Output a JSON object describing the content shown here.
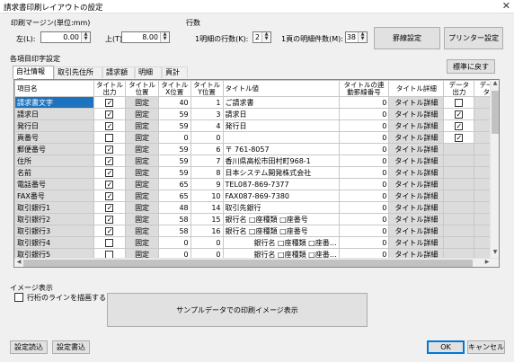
{
  "window": {
    "title": "請求書印刷レイアウトの設定",
    "close": "✕"
  },
  "margin": {
    "group_label": "印刷マージン(単位:mm)",
    "left_label": "左(L):",
    "left_value": "0.00",
    "top_label": "上(T):",
    "top_value": "8.00"
  },
  "rows_group": {
    "label": "行数",
    "detail_rows_label": "1明細の行数(K):",
    "detail_rows_value": "2",
    "page_rows_label": "1頁の明細件数(M):",
    "page_rows_value": "38"
  },
  "buttons": {
    "ruled_line": "罫線設定",
    "printer": "プリンター設定",
    "reset_default": "標準に戻す",
    "sample_preview": "サンプルデータでの印刷イメージ表示",
    "load_settings": "設定読込",
    "save_settings": "設定書込",
    "ok": "OK",
    "cancel": "キャンセル"
  },
  "items_group": {
    "label": "各項目印字設定"
  },
  "tabs": [
    "自社情報欄",
    "取引先住所欄",
    "請求額欄",
    "明細欄",
    "頁計欄"
  ],
  "grid": {
    "headers": [
      "項目名",
      "タイトル出力",
      "タイトル位置",
      "タイトルX位置",
      "タイトルY位置",
      "タイトル値",
      "タイトルの連動罫線番号",
      "タイトル詳細",
      "データ出力",
      "データ"
    ],
    "rows": [
      {
        "name": "請求書文字",
        "title_out": true,
        "pos": "固定",
        "x": "40",
        "y": "1",
        "value": "ご請求書",
        "link": "0",
        "detail": "タイトル詳細",
        "data_out": false,
        "sel": true
      },
      {
        "name": "請求日",
        "title_out": true,
        "pos": "固定",
        "x": "59",
        "y": "3",
        "value": "請求日",
        "link": "0",
        "detail": "タイトル詳細",
        "data_out": true
      },
      {
        "name": "発行日",
        "title_out": true,
        "pos": "固定",
        "x": "59",
        "y": "4",
        "value": "発行日",
        "link": "0",
        "detail": "タイトル詳細",
        "data_out": true
      },
      {
        "name": "頁番号",
        "title_out": false,
        "pos": "固定",
        "x": "0",
        "y": "0",
        "value": "",
        "link": "0",
        "detail": "タイトル詳細",
        "data_out": true
      },
      {
        "name": "郵便番号",
        "title_out": true,
        "pos": "固定",
        "x": "59",
        "y": "6",
        "value": "〒 761-8057",
        "link": "0",
        "detail": "タイトル詳細",
        "data_out": null
      },
      {
        "name": "住所",
        "title_out": true,
        "pos": "固定",
        "x": "59",
        "y": "7",
        "value": "香川県高松市田村町968-1",
        "link": "0",
        "detail": "タイトル詳細",
        "data_out": null
      },
      {
        "name": "名前",
        "title_out": true,
        "pos": "固定",
        "x": "59",
        "y": "8",
        "value": "日本システム開発株式会社",
        "link": "0",
        "detail": "タイトル詳細",
        "data_out": null
      },
      {
        "name": "電話番号",
        "title_out": true,
        "pos": "固定",
        "x": "65",
        "y": "9",
        "value": "TEL087-869-7377",
        "link": "0",
        "detail": "タイトル詳細",
        "data_out": null
      },
      {
        "name": "FAX番号",
        "title_out": true,
        "pos": "固定",
        "x": "65",
        "y": "10",
        "value": "FAX087-869-7380",
        "link": "0",
        "detail": "タイトル詳細",
        "data_out": null
      },
      {
        "name": "取引銀行1",
        "title_out": true,
        "pos": "固定",
        "x": "48",
        "y": "14",
        "value": "取引先銀行",
        "link": "0",
        "detail": "タイトル詳細",
        "data_out": null
      },
      {
        "name": "取引銀行2",
        "title_out": true,
        "pos": "固定",
        "x": "58",
        "y": "15",
        "value": "銀行名 □座種類 □座番号",
        "link": "0",
        "detail": "タイトル詳細",
        "data_out": null
      },
      {
        "name": "取引銀行3",
        "title_out": true,
        "pos": "固定",
        "x": "58",
        "y": "16",
        "value": "銀行名 □座種類 □座番号",
        "link": "0",
        "detail": "タイトル詳細",
        "data_out": null
      },
      {
        "name": "取引銀行4",
        "title_out": false,
        "pos": "固定",
        "x": "0",
        "y": "0",
        "value": "　　　　銀行名 □座種類 □座番…",
        "link": "0",
        "detail": "タイトル詳細",
        "data_out": null
      },
      {
        "name": "取引銀行5",
        "title_out": false,
        "pos": "固定",
        "x": "0",
        "y": "0",
        "value": "　　　　銀行名 □座種類 □座番…",
        "link": "0",
        "detail": "タイトル詳細",
        "data_out": null
      }
    ]
  },
  "image_group": {
    "label": "イメージ表示",
    "checkbox_label": "行桁のラインを描画する"
  }
}
